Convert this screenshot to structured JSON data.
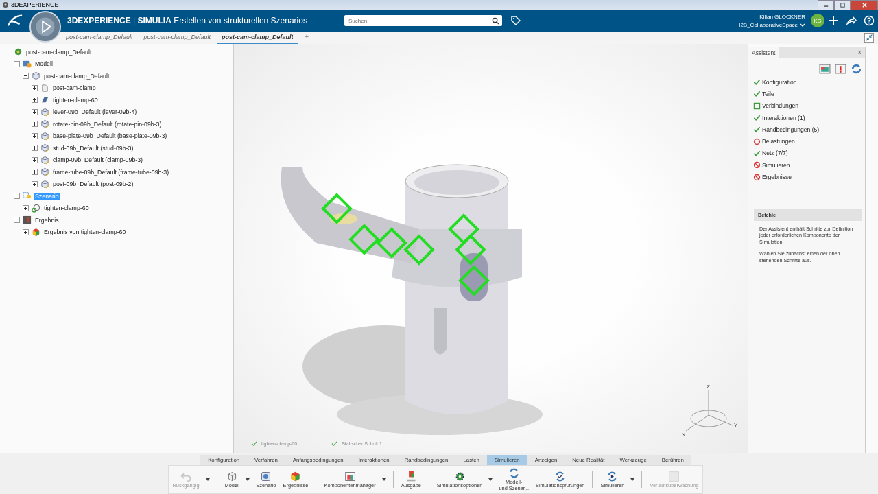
{
  "window": {
    "title": "3DEXPERIENCE"
  },
  "header": {
    "brand": "3DEXPERIENCE",
    "separator": "|",
    "app": "SIMULIA",
    "title": "Erstellen von strukturellen Szenarios",
    "search": {
      "placeholder": "Suchen"
    },
    "user": "Kilian GLOCKNER",
    "space": "H2B_CollaborativeSpace",
    "avatar": "KG"
  },
  "tabs": [
    {
      "label": "post-cam-clamp_Default",
      "selected": false
    },
    {
      "label": "post-cam-clamp_Default",
      "selected": false
    },
    {
      "label": "post-cam-clamp_Default",
      "selected": true
    },
    {
      "label": "+",
      "selected": false
    }
  ],
  "tree": {
    "label": "post-cam-clamp_Default",
    "kind": "root",
    "selected": false,
    "children": [
      {
        "label": "Modell",
        "kind": "model",
        "expanded": true,
        "selected": false,
        "children": [
          {
            "label": "post-cam-clamp_Default",
            "kind": "assembly",
            "expanded": true,
            "selected": false,
            "children": [
              {
                "label": "post-cam-clamp",
                "kind": "shape",
                "expanded": false,
                "selected": false
              },
              {
                "label": "tighten-clamp-60",
                "kind": "mesh",
                "expanded": false,
                "selected": false
              },
              {
                "label": "lever-09b_Default (lever-09b-4)",
                "kind": "part",
                "expanded": false,
                "selected": false
              },
              {
                "label": "rotate-pin-09b_Default (rotate-pin-09b-3)",
                "kind": "part",
                "expanded": false,
                "selected": false
              },
              {
                "label": "base-plate-09b_Default (base-plate-09b-3)",
                "kind": "part",
                "expanded": false,
                "selected": false
              },
              {
                "label": "stud-09b_Default (stud-09b-3)",
                "kind": "part",
                "expanded": false,
                "selected": false
              },
              {
                "label": "clamp-09b_Default (clamp-09b-3)",
                "kind": "part",
                "expanded": false,
                "selected": false
              },
              {
                "label": "frame-tube-09b_Default (frame-tube-09b-3)",
                "kind": "part",
                "expanded": false,
                "selected": false
              },
              {
                "label": "post-09b_Default (post-09b-2)",
                "kind": "part",
                "expanded": false,
                "selected": false
              }
            ]
          }
        ]
      },
      {
        "label": "Szenario",
        "kind": "scenario",
        "expanded": true,
        "selected": true,
        "children": [
          {
            "label": "tighten-clamp-60",
            "kind": "step",
            "expanded": false,
            "selected": false
          }
        ]
      },
      {
        "label": "Ergebnis",
        "kind": "result",
        "expanded": true,
        "selected": false,
        "children": [
          {
            "label": "Ergebnis von tighten-clamp-60",
            "kind": "resultitem",
            "expanded": false,
            "selected": false
          }
        ]
      }
    ]
  },
  "viewport": {
    "steps": [
      {
        "label": "tighten-clamp-60"
      },
      {
        "label": "Statischer Schritt.1"
      }
    ],
    "axes": [
      "Z",
      "Y",
      "X"
    ]
  },
  "assistant": {
    "title": "Assistent",
    "close": "×",
    "steps": [
      {
        "label": "Konfiguration",
        "kind": "done"
      },
      {
        "label": "Teile",
        "kind": "done"
      },
      {
        "label": "Verbindungen",
        "kind": "optional"
      },
      {
        "label": "Interaktionen (1)",
        "kind": "done"
      },
      {
        "label": "Randbedingungen (5)",
        "kind": "done"
      },
      {
        "label": "Belastungen",
        "kind": "missing"
      },
      {
        "label": "Netz (7/7)",
        "kind": "done"
      },
      {
        "label": "Simulieren",
        "kind": "blocked"
      },
      {
        "label": "Ergebnisse",
        "kind": "blocked"
      }
    ],
    "commands_title": "Befehle",
    "paragraphs": [
      "Der Assistent enthält Schritte zur Definition jeder erforderlichen Komponente der Simulation.",
      "Wählen Sie zunächst einen der oben stehenden Schritte aus."
    ]
  },
  "ribbon_tabs": [
    {
      "label": "Konfiguration",
      "selected": false
    },
    {
      "label": "Verfahren",
      "selected": false
    },
    {
      "label": "Anfangsbedingungen",
      "selected": false
    },
    {
      "label": "Interaktionen",
      "selected": false
    },
    {
      "label": "Randbedingungen",
      "selected": false
    },
    {
      "label": "Lasten",
      "selected": false
    },
    {
      "label": "Simulieren",
      "selected": true
    },
    {
      "label": "Anzeigen",
      "selected": false
    },
    {
      "label": "Neue Realität",
      "selected": false
    },
    {
      "label": "Werkzeuge",
      "selected": false
    },
    {
      "label": "Berühren",
      "selected": false
    }
  ],
  "tools": [
    {
      "label": "Rückgängig",
      "kind": "undo",
      "disabled": true,
      "dropdown": true
    },
    {
      "label": "Modell",
      "kind": "model",
      "disabled": false,
      "dropdown": true
    },
    {
      "label": "Szenario",
      "kind": "scenario",
      "disabled": false,
      "dropdown": false
    },
    {
      "label": "Ergebnisse",
      "kind": "results",
      "disabled": false,
      "dropdown": false
    },
    {
      "label": "Komponentenmanager",
      "kind": "manager",
      "disabled": false,
      "dropdown": true
    },
    {
      "label": "Ausgabe",
      "kind": "output",
      "disabled": false,
      "dropdown": false
    },
    {
      "label": "Simulationsoptionen",
      "kind": "options",
      "disabled": false,
      "dropdown": true
    },
    {
      "label": "Modell-\nund Szenar...",
      "kind": "sync",
      "disabled": false,
      "dropdown": false
    },
    {
      "label": "Simulationsprüfungen",
      "kind": "check",
      "disabled": false,
      "dropdown": false
    },
    {
      "label": "Simulieren",
      "kind": "simulate",
      "disabled": false,
      "dropdown": true
    },
    {
      "label": "Verlaufsüberwachung",
      "kind": "monitor",
      "disabled": true,
      "dropdown": false
    }
  ]
}
